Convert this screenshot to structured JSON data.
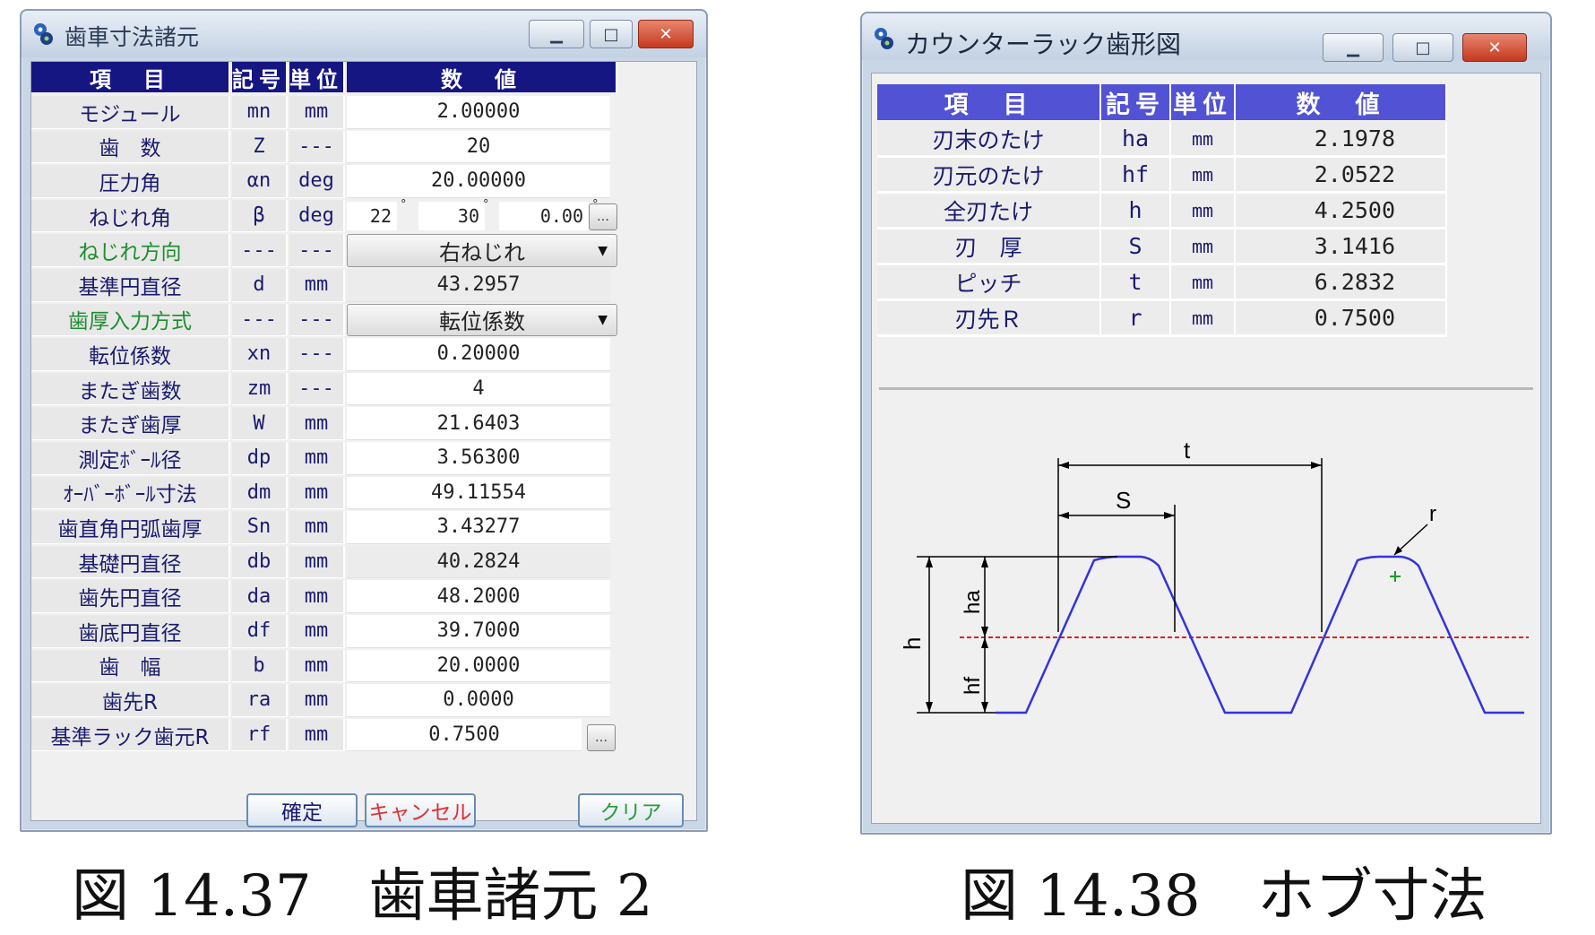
{
  "window1": {
    "title": "歯車寸法諸元",
    "headers": [
      "項　目",
      "記号",
      "単位",
      "数　値"
    ],
    "rows": [
      {
        "name": "モジュール",
        "sym": "mn",
        "unit": "mm",
        "value": "2.00000",
        "kind": "input"
      },
      {
        "name": "歯　数",
        "sym": "Z",
        "unit": "---",
        "value": "20",
        "kind": "input"
      },
      {
        "name": "圧力角",
        "sym": "αn",
        "unit": "deg",
        "value": "20.00000",
        "kind": "input"
      },
      {
        "name": "ねじれ角",
        "sym": "β",
        "unit": "deg",
        "kind": "deg",
        "deg": "22",
        "min": "30",
        "sec": "0.00"
      },
      {
        "name": "ねじれ方向",
        "sym": "---",
        "unit": "---",
        "value": "右ねじれ",
        "kind": "combo",
        "green": true
      },
      {
        "name": "基準円直径",
        "sym": "d",
        "unit": "mm",
        "value": "43.2957",
        "kind": "readonly"
      },
      {
        "name": "歯厚入力方式",
        "sym": "---",
        "unit": "---",
        "value": "転位係数",
        "kind": "combo",
        "green": true
      },
      {
        "name": "転位係数",
        "sym": "xn",
        "unit": "---",
        "value": "0.20000",
        "kind": "input"
      },
      {
        "name": "またぎ歯数",
        "sym": "zm",
        "unit": "---",
        "value": "4",
        "kind": "input"
      },
      {
        "name": "またぎ歯厚",
        "sym": "W",
        "unit": "mm",
        "value": "21.6403",
        "kind": "input"
      },
      {
        "name": "測定ﾎﾞｰﾙ径",
        "sym": "dp",
        "unit": "mm",
        "value": "3.56300",
        "kind": "input"
      },
      {
        "name": "ｵｰﾊﾞｰﾎﾞｰﾙ寸法",
        "sym": "dm",
        "unit": "mm",
        "value": "49.11554",
        "kind": "input"
      },
      {
        "name": "歯直角円弧歯厚",
        "sym": "Sn",
        "unit": "mm",
        "value": "3.43277",
        "kind": "input"
      },
      {
        "name": "基礎円直径",
        "sym": "db",
        "unit": "mm",
        "value": "40.2824",
        "kind": "readonly"
      },
      {
        "name": "歯先円直径",
        "sym": "da",
        "unit": "mm",
        "value": "48.2000",
        "kind": "input"
      },
      {
        "name": "歯底円直径",
        "sym": "df",
        "unit": "mm",
        "value": "39.7000",
        "kind": "input"
      },
      {
        "name": "歯　幅",
        "sym": "b",
        "unit": "mm",
        "value": "20.0000",
        "kind": "input"
      },
      {
        "name": "歯先R",
        "sym": "ra",
        "unit": "mm",
        "value": "0.0000",
        "kind": "input"
      },
      {
        "name": "基準ラック歯元R",
        "sym": "rf",
        "unit": "mm",
        "value": "0.7500",
        "kind": "input",
        "browse": true
      }
    ],
    "buttons": {
      "ok": "確定",
      "cancel": "キャンセル",
      "clear": "クリア"
    }
  },
  "window2": {
    "title": "カウンターラック歯形図",
    "headers": [
      "項　目",
      "記号",
      "単位",
      "数　値"
    ],
    "rows": [
      {
        "name": "刃末のたけ",
        "sym": "ha",
        "unit": "mm",
        "value": "2.1978"
      },
      {
        "name": "刃元のたけ",
        "sym": "hf",
        "unit": "mm",
        "value": "2.0522"
      },
      {
        "name": "全刃たけ",
        "sym": "h",
        "unit": "mm",
        "value": "4.2500"
      },
      {
        "name": "刃　厚",
        "sym": "S",
        "unit": "mm",
        "value": "3.1416"
      },
      {
        "name": "ピッチ",
        "sym": "t",
        "unit": "mm",
        "value": "6.2832"
      },
      {
        "name": "刃先Ｒ",
        "sym": "r",
        "unit": "mm",
        "value": "0.7500"
      }
    ],
    "diagram_labels": {
      "t": "t",
      "S": "S",
      "r": "r",
      "h": "h",
      "ha": "ha",
      "hf": "hf"
    }
  },
  "captions": {
    "left": "図 14.37　歯車諸元 2",
    "right": "図 14.38　ホブ寸法"
  },
  "colors": {
    "header": "#161682",
    "header2": "#5252d4",
    "profile": "#3333dd",
    "pitchline": "#dd2222",
    "close": "#c5391f"
  }
}
